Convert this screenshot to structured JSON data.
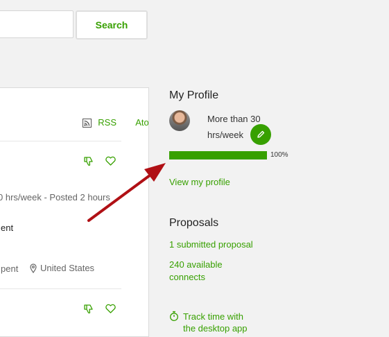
{
  "search": {
    "button_label": "Search",
    "placeholder": ""
  },
  "feed": {
    "rss_label": "RSS",
    "atom_label": "Atom",
    "job": {
      "meta": "0 hrs/week - Posted 2 hours",
      "description": "ent",
      "spent": "pent",
      "location": "United States"
    }
  },
  "profile": {
    "title": "My Profile",
    "availability_line1": "More than 30",
    "availability_line2": "hrs/week",
    "progress_percent": 100,
    "progress_label": "100%",
    "view_profile": "View my profile"
  },
  "proposals": {
    "title": "Proposals",
    "submitted": "1 submitted proposal",
    "connects_line1": "240 available",
    "connects_line2": "connects"
  },
  "track_time": {
    "line1": "Track time with",
    "line2": "the desktop app"
  },
  "colors": {
    "accent": "#37a000",
    "arrow": "#b01015"
  }
}
